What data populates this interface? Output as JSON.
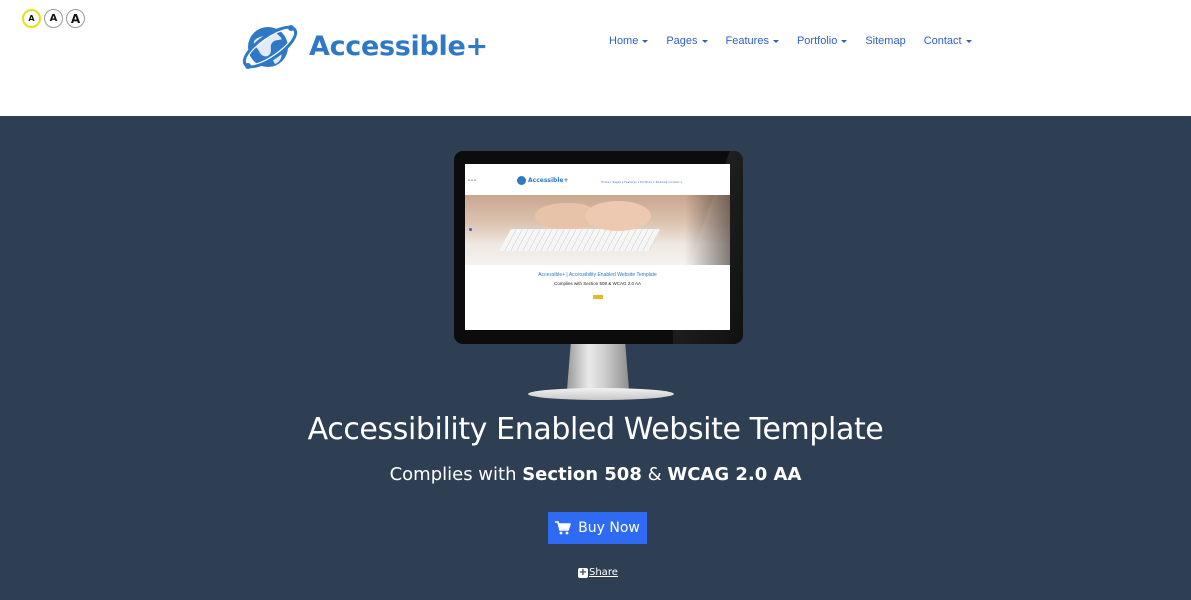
{
  "font_sizer": {
    "small": "A",
    "medium": "A",
    "large": "A"
  },
  "brand": {
    "name": "Accessible+",
    "color": "#2f78c4"
  },
  "nav": {
    "items": [
      {
        "label": "Home",
        "dropdown": true
      },
      {
        "label": "Pages",
        "dropdown": true
      },
      {
        "label": "Features",
        "dropdown": true
      },
      {
        "label": "Portfolio",
        "dropdown": true
      },
      {
        "label": "Sitemap",
        "dropdown": false
      },
      {
        "label": "Contact",
        "dropdown": true
      }
    ]
  },
  "hero": {
    "background": "#2e3e53",
    "title": "Accessibility Enabled Website Template",
    "subtitle_prefix": "Complies with ",
    "subtitle_strong1": "Section 508",
    "subtitle_mid": " & ",
    "subtitle_strong2": "WCAG 2.0 AA",
    "buy_label": "Buy Now",
    "buy_icon": "shopping-cart-icon",
    "buy_color": "#2f6af2",
    "share_label": "Share",
    "share_icon": "plus-square-icon"
  },
  "preview": {
    "logo": "Accessible+",
    "nav": "Home ▾   Pages ▾   Features ▾   Portfolio ▾   Sitemap   Contact ▾",
    "title": "Accessible+ | Accessibility Enabled Website Template",
    "subtitle": "Complies with Section 508 & WCAG 2.0 AA",
    "dots": "A A A"
  }
}
